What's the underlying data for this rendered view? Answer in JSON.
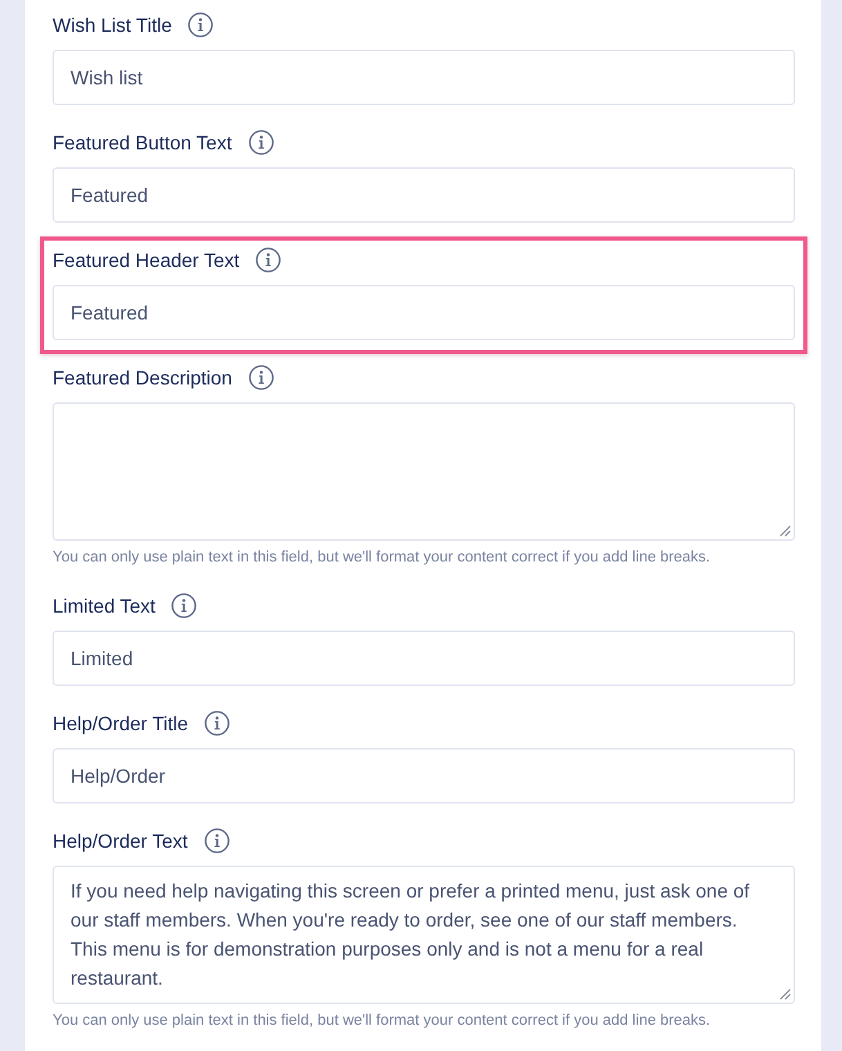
{
  "form": {
    "fields": [
      {
        "kind": "input",
        "label": "Wish List Title",
        "value": "Wish list",
        "highlighted": false
      },
      {
        "kind": "input",
        "label": "Featured Button Text",
        "value": "Featured",
        "highlighted": false
      },
      {
        "kind": "input",
        "label": "Featured Header Text",
        "value": "Featured",
        "highlighted": true
      },
      {
        "kind": "textarea",
        "label": "Featured Description",
        "hint": "You can only use plain text in this field, but we'll format your content correct if you add line breaks.",
        "highlighted": false
      },
      {
        "kind": "input",
        "label": "Limited Text",
        "value": "Limited",
        "highlighted": false
      },
      {
        "kind": "input",
        "label": "Help/Order Title",
        "value": "Help/Order",
        "highlighted": false
      },
      {
        "kind": "textarea",
        "label": "Help/Order Text",
        "value": "If you need help navigating this screen or prefer a printed menu, just ask one of our staff members. When you're ready to order, see one of our staff members. This menu is for demonstration purposes only and is not a menu for a real restaurant.",
        "hint": "You can only use plain text in this field, but we'll format your content correct if you add line breaks.",
        "highlighted": false
      }
    ]
  }
}
